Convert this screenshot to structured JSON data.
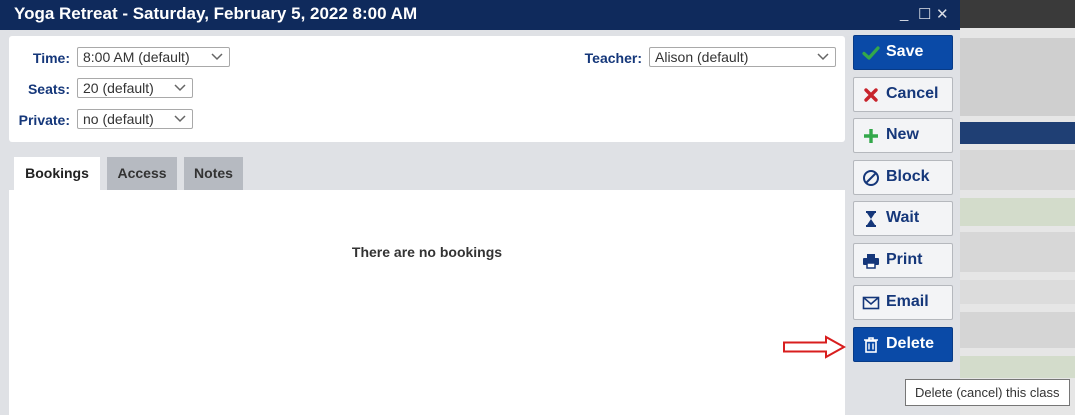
{
  "window": {
    "title": "Yoga Retreat - Saturday, February 5, 2022 8:00 AM",
    "controls": {
      "minimize": "_",
      "maximize": "☐",
      "close": "✕"
    }
  },
  "form": {
    "time": {
      "label": "Time:",
      "value": "8:00 AM (default)"
    },
    "seats": {
      "label": "Seats:",
      "value": "20 (default)"
    },
    "private": {
      "label": "Private:",
      "value": "no (default)"
    },
    "teacher": {
      "label": "Teacher:",
      "value": "Alison (default)"
    }
  },
  "tabs": [
    {
      "label": "Bookings",
      "active": true
    },
    {
      "label": "Access",
      "active": false
    },
    {
      "label": "Notes",
      "active": false
    }
  ],
  "bookings": {
    "empty_message": "There are no bookings"
  },
  "actions": [
    {
      "label": "Save",
      "icon": "check-icon"
    },
    {
      "label": "Cancel",
      "icon": "x-icon"
    },
    {
      "label": "New",
      "icon": "plus-icon"
    },
    {
      "label": "Block",
      "icon": "block-icon"
    },
    {
      "label": "Wait",
      "icon": "hourglass-icon"
    },
    {
      "label": "Print",
      "icon": "printer-icon"
    },
    {
      "label": "Email",
      "icon": "envelope-icon"
    },
    {
      "label": "Delete",
      "icon": "trash-icon"
    }
  ],
  "tooltip": {
    "text": "Delete (cancel) this class"
  },
  "colors": {
    "titlebar": "#0f2a5c",
    "primary_button": "#0a4aa7",
    "label_text": "#15377a",
    "check_green": "#33a84a",
    "cancel_red": "#c8242c",
    "arrow_red": "#d81e1e"
  }
}
